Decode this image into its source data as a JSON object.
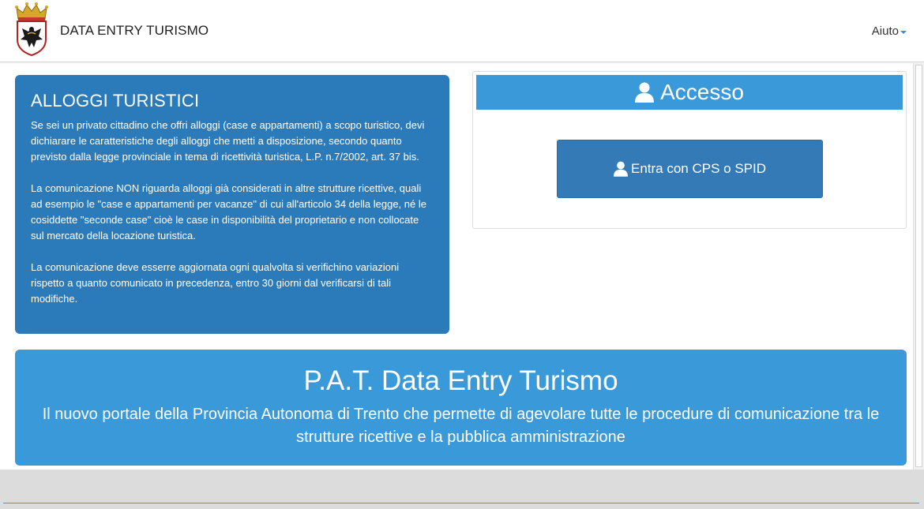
{
  "header": {
    "brand": "DATA ENTRY TURISMO",
    "help_label": "Aiuto"
  },
  "info": {
    "title": "ALLOGGI TURISTICI",
    "paragraphs": [
      "Se sei un privato cittadino che offri alloggi (case e appartamenti) a scopo turistico, devi dichiarare le caratteristiche degli alloggi che metti a disposizione, secondo quanto previsto dalla legge provinciale in tema di ricettività turistica, L.P. n.7/2002, art. 37 bis.",
      "La comunicazione NON riguarda alloggi già considerati in altre strutture ricettive, quali ad esempio le \"case e appartamenti per vacanze\" di cui all'articolo 34 della legge, né le cosiddette \"seconde case\" cioè le case in disponibilità del proprietario e non collocate sul mercato della locazione turistica.",
      "La comunicazione deve esserre aggiornata ogni qualvolta si verifichino variazioni rispetto a quanto comunicato in precedenza, entro 30 giorni dal verificarsi di tali modifiche."
    ]
  },
  "access": {
    "title": "Accesso",
    "login_label": "Entra con CPS o SPID"
  },
  "banner": {
    "title": "P.A.T. Data Entry Turismo",
    "subtitle": "Il nuovo portale della Provincia Autonoma di Trento che permette di agevolare tutte le procedure di comunicazione tra le strutture ricettive e la pubblica amministrazione"
  },
  "colors": {
    "panel_dark": "#2b7bbb",
    "panel_light": "#3a9ad9",
    "button": "#337ab7"
  },
  "icons": {
    "logo": "trentino-eagle-crest",
    "user": "user-icon",
    "caret": "caret-down-icon"
  }
}
